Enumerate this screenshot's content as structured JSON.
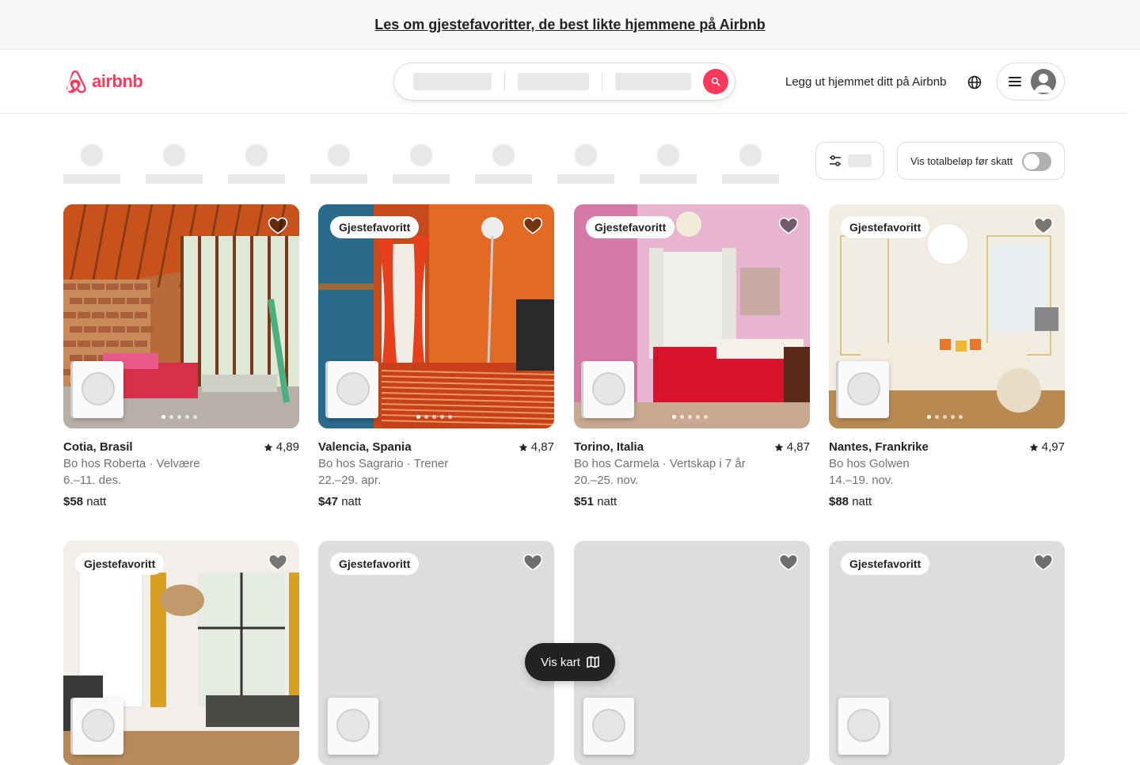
{
  "banner": {
    "text": "Les om gjestefavoritter, de best likte hjemmene på Airbnb"
  },
  "header": {
    "logo_text": "airbnb",
    "host_link": "Legg ut hjemmet ditt på Airbnb"
  },
  "filters": {
    "tax_toggle_label": "Vis totalbeløp før skatt",
    "tax_toggle_on": false
  },
  "listings": [
    {
      "location": "Cotia, Brasil",
      "rating": "4,89",
      "host": "Bo hos Roberta · Velvære",
      "dates": "6.–11. des.",
      "price": "$58",
      "unit": "natt",
      "badge": "",
      "photo": "sunroom"
    },
    {
      "location": "Valencia, Spania",
      "rating": "4,87",
      "host": "Bo hos Sagrario · Trener",
      "dates": "22.–29. apr.",
      "price": "$47",
      "unit": "natt",
      "badge": "Gjestefavoritt",
      "photo": "orange-room"
    },
    {
      "location": "Torino, Italia",
      "rating": "4,87",
      "host": "Bo hos Carmela · Vertskap i 7 år",
      "dates": "20.–25. nov.",
      "price": "$51",
      "unit": "natt",
      "badge": "Gjestefavoritt",
      "photo": "pink-room"
    },
    {
      "location": "Nantes, Frankrike",
      "rating": "4,97",
      "host": "Bo hos Golwen",
      "dates": "14.–19. nov.",
      "price": "$88",
      "unit": "natt",
      "badge": "Gjestefavoritt",
      "photo": "living-room"
    }
  ],
  "listings_row2": [
    {
      "badge": "Gjestefavoritt",
      "photo": "apartment"
    },
    {
      "badge": "Gjestefavoritt",
      "photo": "loading"
    },
    {
      "badge": "",
      "photo": "loading"
    },
    {
      "badge": "Gjestefavoritt",
      "photo": "loading"
    }
  ],
  "map_button": {
    "label": "Vis kart"
  },
  "colors": {
    "brand": "#ff385c",
    "text": "#222222",
    "muted": "#717171"
  }
}
